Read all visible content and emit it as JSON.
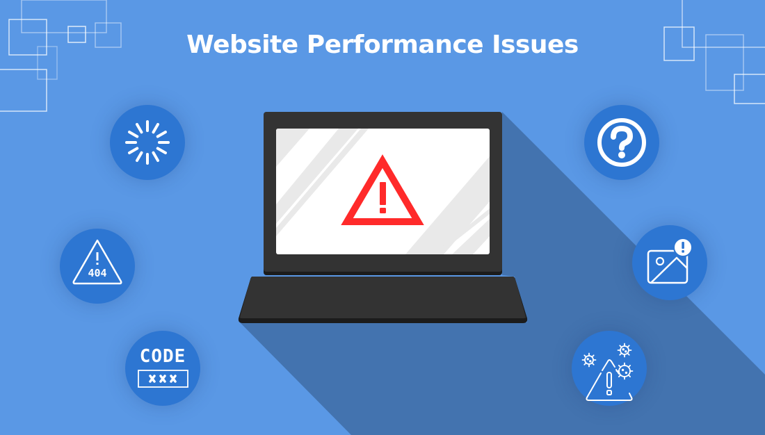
{
  "title": "Website Performance Issues",
  "colors": {
    "background": "#5A98E5",
    "shadow": "#4373AF",
    "badge": "#2D76D2",
    "laptop": "#333333",
    "laptop_edge": "#1C1C1C",
    "screen": "#FFFFFF",
    "warning": "#FF2A2A"
  },
  "laptop": {
    "screen_icon": "warning-triangle-icon"
  },
  "issues": [
    {
      "id": "slow-loading",
      "icon": "loading-spinner-icon"
    },
    {
      "id": "not-found",
      "icon": "warning-404-icon",
      "label": "404"
    },
    {
      "id": "code-errors",
      "icon": "code-error-icon",
      "label": "CODE"
    },
    {
      "id": "unknown-issue",
      "icon": "question-mark-icon"
    },
    {
      "id": "image-issues",
      "icon": "broken-image-icon"
    },
    {
      "id": "malware",
      "icon": "virus-warning-icon"
    }
  ]
}
